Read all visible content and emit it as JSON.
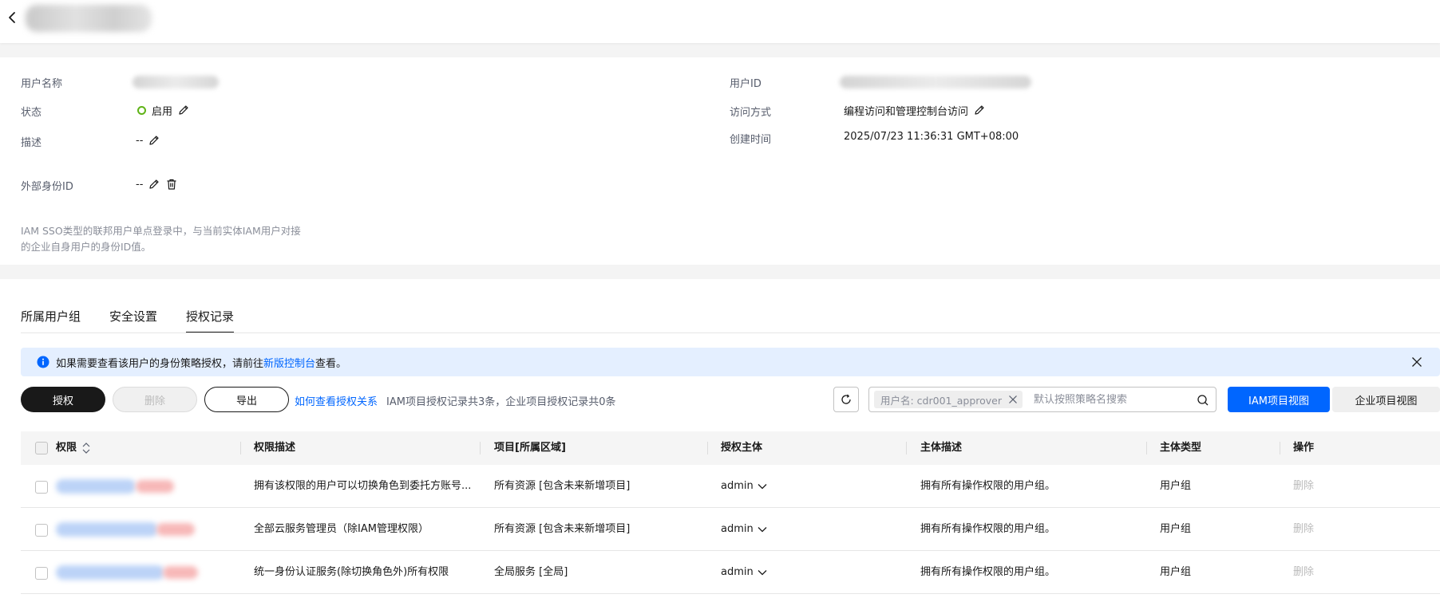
{
  "colors": {
    "primary": "#0066ff",
    "status_green": "#5fb317",
    "alert_bg": "#e4efff",
    "dark_button": "#191919"
  },
  "user_info": {
    "username_label": "用户名称",
    "userid_label": "用户ID",
    "status_label": "状态",
    "status_value": "启用",
    "access_label": "访问方式",
    "access_value": "编程访问和管理控制台访问",
    "desc_label": "描述",
    "desc_value": "--",
    "created_label": "创建时间",
    "created_value": "2025/07/23 11:36:31 GMT+08:00",
    "external_id_label": "外部身份ID",
    "external_id_value": "--",
    "external_id_hint": "IAM SSO类型的联邦用户单点登录中，与当前实体IAM用户对接的企业自身用户的身份ID值。"
  },
  "tabs": [
    {
      "label": "所属用户组",
      "active": false
    },
    {
      "label": "安全设置",
      "active": false
    },
    {
      "label": "授权记录",
      "active": true
    }
  ],
  "alert": {
    "text_before": "如果需要查看该用户的身份策略授权，请前往",
    "link": "新版控制台",
    "text_after": "查看。"
  },
  "toolbar": {
    "grant_label": "授权",
    "delete_label": "删除",
    "export_label": "导出",
    "help_link": "如何查看授权关系",
    "count_text": "IAM项目授权记录共3条，企业项目授权记录共0条",
    "filter_tag": "用户名: cdr001_approver",
    "search_placeholder": "默认按照策略名搜索",
    "view_iam": "IAM项目视图",
    "view_enterprise": "企业项目视图"
  },
  "table": {
    "columns": [
      "权限",
      "权限描述",
      "项目[所属区域]",
      "授权主体",
      "主体描述",
      "主体类型",
      "操作"
    ],
    "rows": [
      {
        "description": "拥有该权限的用户可以切换角色到委托方账号...",
        "project": "所有资源 [包含未来新增项目]",
        "principal": "admin",
        "principal_desc": "拥有所有操作权限的用户组。",
        "principal_type": "用户组",
        "action": "删除"
      },
      {
        "description": "全部云服务管理员（除IAM管理权限）",
        "project": "所有资源 [包含未来新增项目]",
        "principal": "admin",
        "principal_desc": "拥有所有操作权限的用户组。",
        "principal_type": "用户组",
        "action": "删除"
      },
      {
        "description": "统一身份认证服务(除切换角色外)所有权限",
        "project": "全局服务 [全局]",
        "principal": "admin",
        "principal_desc": "拥有所有操作权限的用户组。",
        "principal_type": "用户组",
        "action": "删除"
      }
    ]
  }
}
